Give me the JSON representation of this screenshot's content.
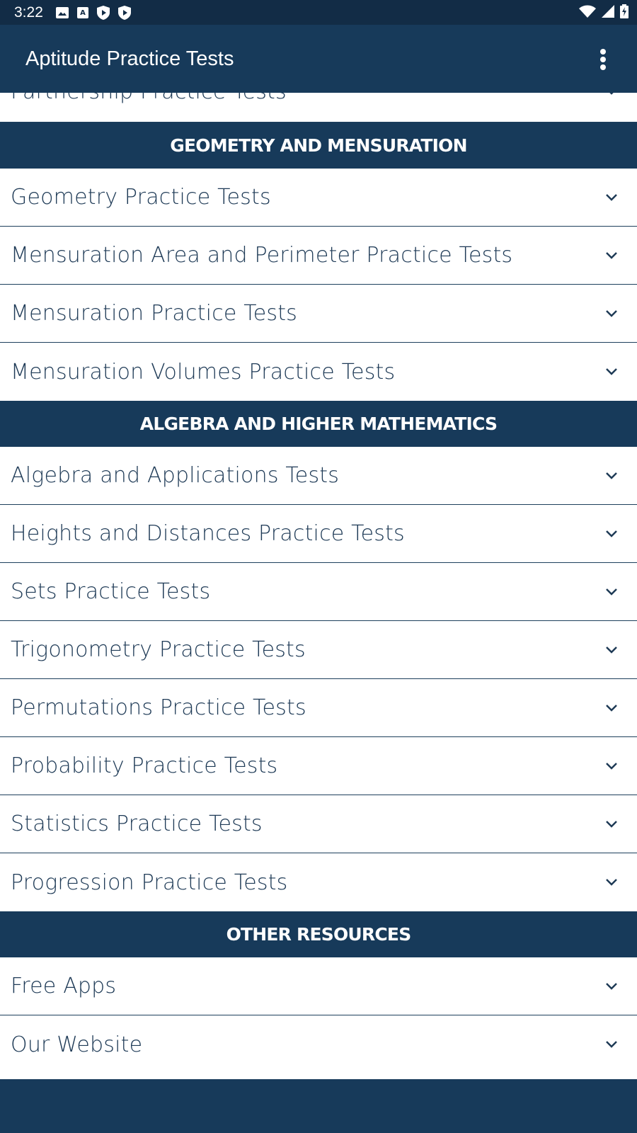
{
  "status_bar": {
    "time": "3:22",
    "left_icons": [
      "image-icon",
      "accessibility-font-icon",
      "play-shield-icon",
      "play-shield-icon"
    ],
    "right_icons": [
      "wifi-icon",
      "signal-icon",
      "battery-charging-icon"
    ]
  },
  "app_bar": {
    "title": "Aptitude Practice Tests",
    "menu_icon": "more-vert-icon"
  },
  "list": {
    "partial_top_item": "Partnership Practice Tests",
    "sections": [
      {
        "title": "GEOMETRY AND MENSURATION",
        "items": [
          "Geometry Practice Tests",
          "Mensuration Area and Perimeter Practice Tests",
          "Mensuration Practice Tests",
          "Mensuration Volumes Practice Tests"
        ]
      },
      {
        "title": "ALGEBRA AND HIGHER MATHEMATICS",
        "items": [
          "Algebra and Applications Tests",
          "Heights and Distances Practice Tests",
          "Sets Practice Tests",
          "Trigonometry Practice Tests",
          "Permutations Practice Tests",
          "Probability Practice Tests",
          "Statistics Practice Tests",
          "Progression Practice Tests"
        ]
      },
      {
        "title": "OTHER RESOURCES",
        "items": [
          "Free Apps",
          "Our Website"
        ]
      }
    ]
  },
  "colors": {
    "primary": "#173a5a",
    "status_bar": "#122c46",
    "text": "#1e3a56",
    "background": "#ffffff"
  }
}
